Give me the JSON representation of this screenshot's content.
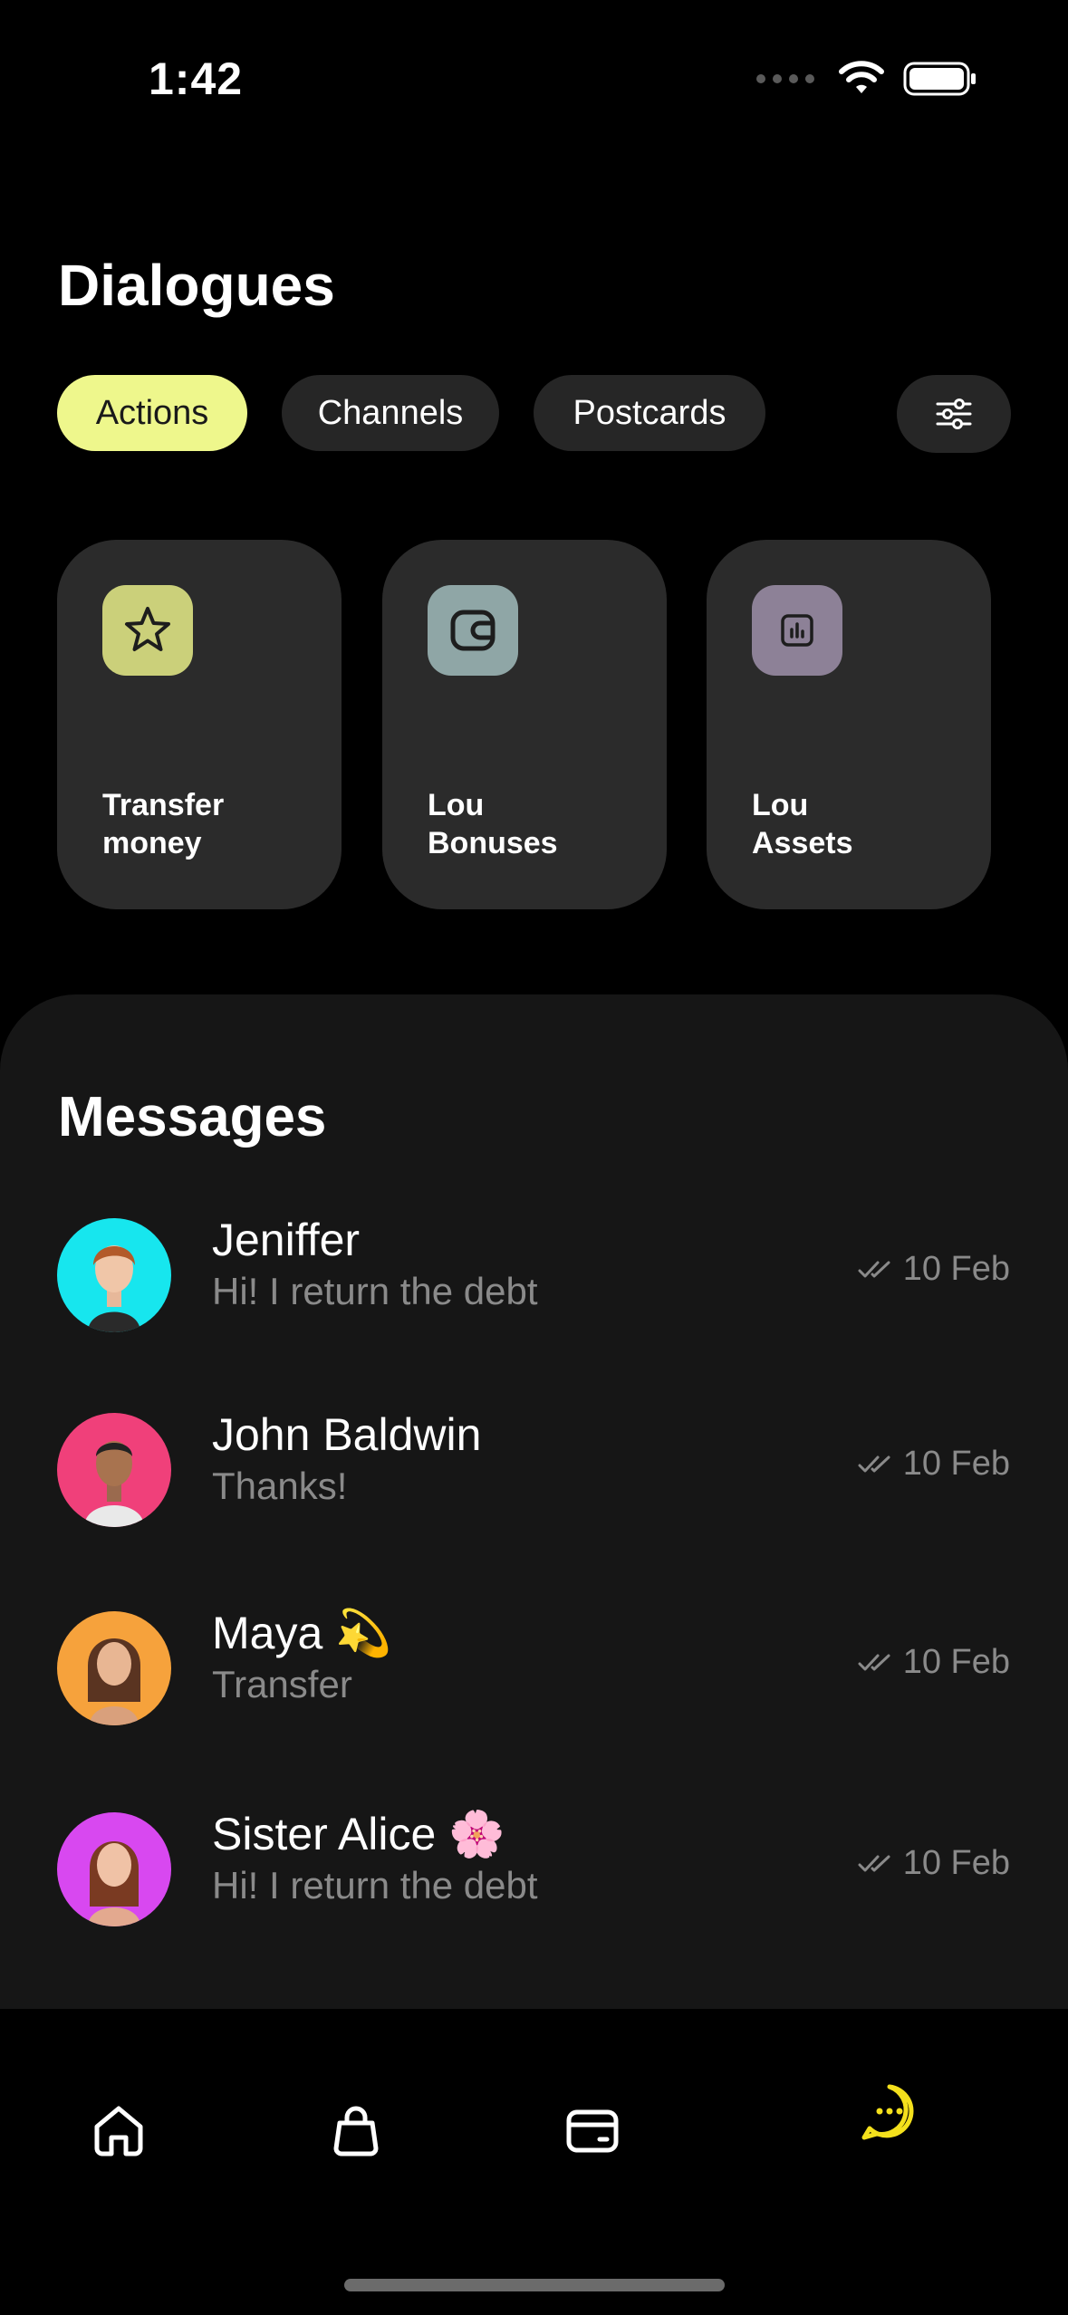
{
  "status_bar": {
    "time": "1:42"
  },
  "header": {
    "title": "Dialogues"
  },
  "filters": {
    "chips": [
      {
        "label": "Actions",
        "active": true
      },
      {
        "label": "Channels",
        "active": false
      },
      {
        "label": "Postcards",
        "active": false
      }
    ],
    "settings_icon": "sliders-icon"
  },
  "actions": [
    {
      "label_line1": "Transfer",
      "label_line2": "money",
      "icon": "star-icon",
      "icon_bg": "#cbd07a"
    },
    {
      "label_line1": "Lou",
      "label_line2": "Bonuses",
      "icon": "wallet-icon",
      "icon_bg": "#8fa6a6"
    },
    {
      "label_line1": "Lou",
      "label_line2": "Assets",
      "icon": "chart-icon",
      "icon_bg": "#8d8197"
    }
  ],
  "messages": {
    "title": "Messages",
    "items": [
      {
        "name": "Jeniffer",
        "preview": "Hi! I return the debt",
        "date": "10 Feb",
        "avatar_bg": "#17e6ee"
      },
      {
        "name": "John Baldwin",
        "preview": "Thanks!",
        "date": "10 Feb",
        "avatar_bg": "#f0407a"
      },
      {
        "name": "Maya 💫",
        "preview": "Transfer",
        "date": "10 Feb",
        "avatar_bg": "#f6a23c"
      },
      {
        "name": "Sister Alice 🌸",
        "preview": "Hi! I return the debt",
        "date": "10 Feb",
        "avatar_bg": "#d848f0"
      }
    ]
  },
  "nav": {
    "items": [
      {
        "icon": "home-icon"
      },
      {
        "icon": "bag-icon"
      },
      {
        "icon": "wallet-icon"
      },
      {
        "icon": "chat-icon",
        "active": true
      }
    ],
    "active_color": "#f4e01c"
  },
  "colors": {
    "accent": "#eef78c",
    "background": "#000000",
    "panel": "#161616",
    "card": "#2b2b2b",
    "muted_text": "#8a8a8a"
  }
}
